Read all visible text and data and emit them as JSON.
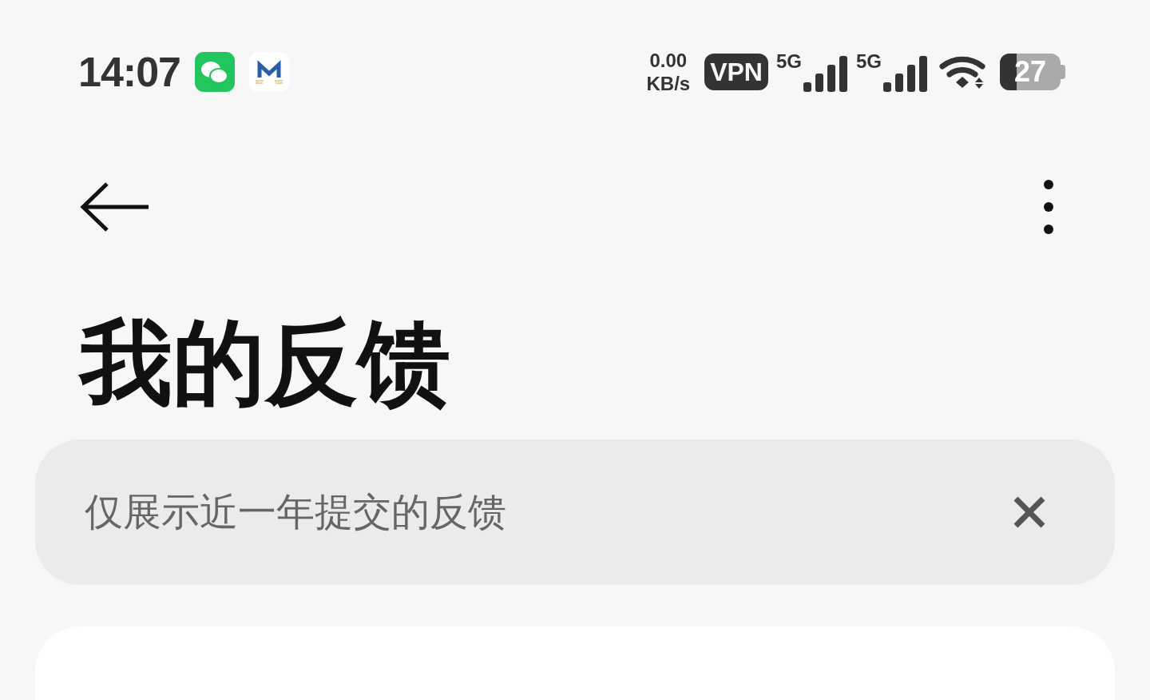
{
  "status_bar": {
    "time": "14:07",
    "net_speed_value": "0.00",
    "net_speed_unit": "KB/s",
    "vpn": "VPN",
    "sim_labels": [
      "5G",
      "5G"
    ],
    "battery": {
      "level": 0.27,
      "reading": "27"
    }
  },
  "title": "我的反馈",
  "notice": {
    "text": "仅展示近一年提交的反馈"
  }
}
